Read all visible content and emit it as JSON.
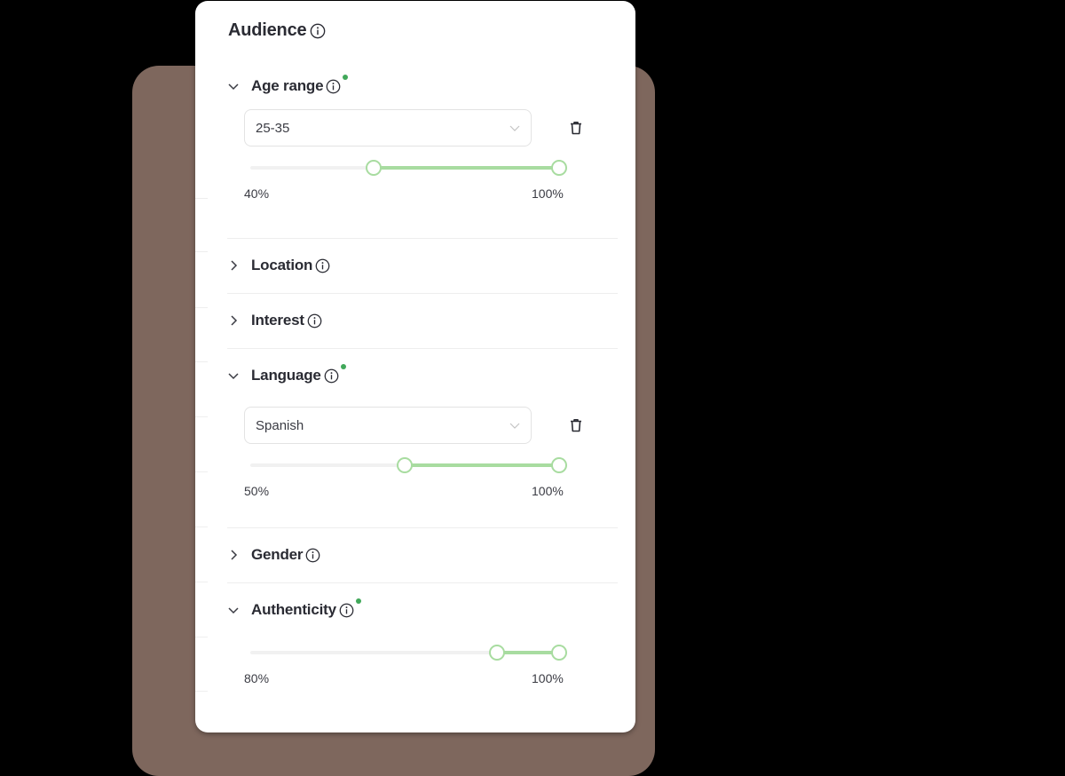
{
  "panel": {
    "title": "Audience",
    "title_icon": "info-icon"
  },
  "colors": {
    "accent_green": "#a8dca0",
    "active_dot": "#41a85a",
    "backdrop": "#7e675d"
  },
  "sections": [
    {
      "label": "Age range",
      "expanded": true,
      "active": true,
      "select_value": "25-35",
      "range": {
        "min_label": "40%",
        "max_label": "100%",
        "low": 0.4,
        "high": 1.0
      }
    },
    {
      "label": "Location",
      "expanded": false,
      "active": false
    },
    {
      "label": "Interest",
      "expanded": false,
      "active": false
    },
    {
      "label": "Language",
      "expanded": true,
      "active": true,
      "select_value": "Spanish",
      "range": {
        "min_label": "50%",
        "max_label": "100%",
        "low": 0.5,
        "high": 1.0
      }
    },
    {
      "label": "Gender",
      "expanded": false,
      "active": false
    },
    {
      "label": "Authenticity",
      "expanded": true,
      "active": true,
      "range": {
        "min_label": "80%",
        "max_label": "100%",
        "low": 0.8,
        "high": 1.0
      }
    }
  ]
}
